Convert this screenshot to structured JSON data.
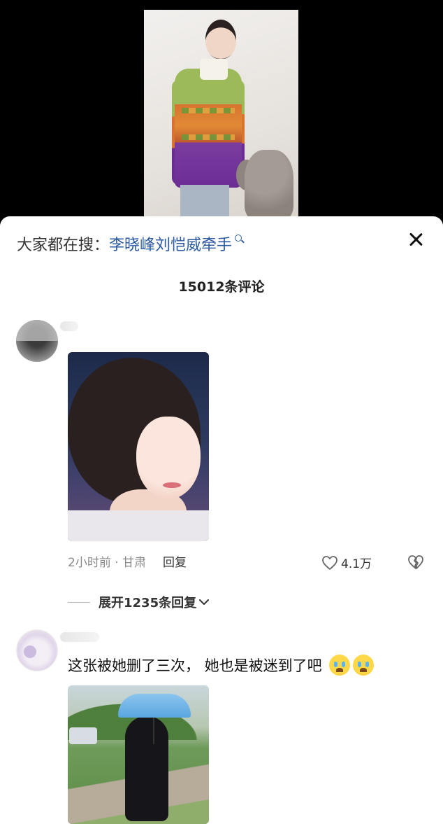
{
  "search": {
    "prefix": "大家都在搜：",
    "term": "李晓峰刘恺威牵手"
  },
  "comments_header": {
    "count_text": "15012条评论"
  },
  "comments": [
    {
      "time_location": "2小时前 · 甘肃",
      "reply_label": "回复",
      "likes": "4.1万",
      "expand_label": "展开1235条回复"
    },
    {
      "text": "这张被她删了三次， 她也是被迷到了吧",
      "emojis": [
        "loudly-crying-face-icon",
        "loudly-crying-face-icon"
      ]
    }
  ],
  "colors": {
    "link_blue": "#2c5aa0",
    "meta_gray": "#8a8a8a",
    "sheet_bg": "#ffffff",
    "video_bg": "#000000"
  }
}
